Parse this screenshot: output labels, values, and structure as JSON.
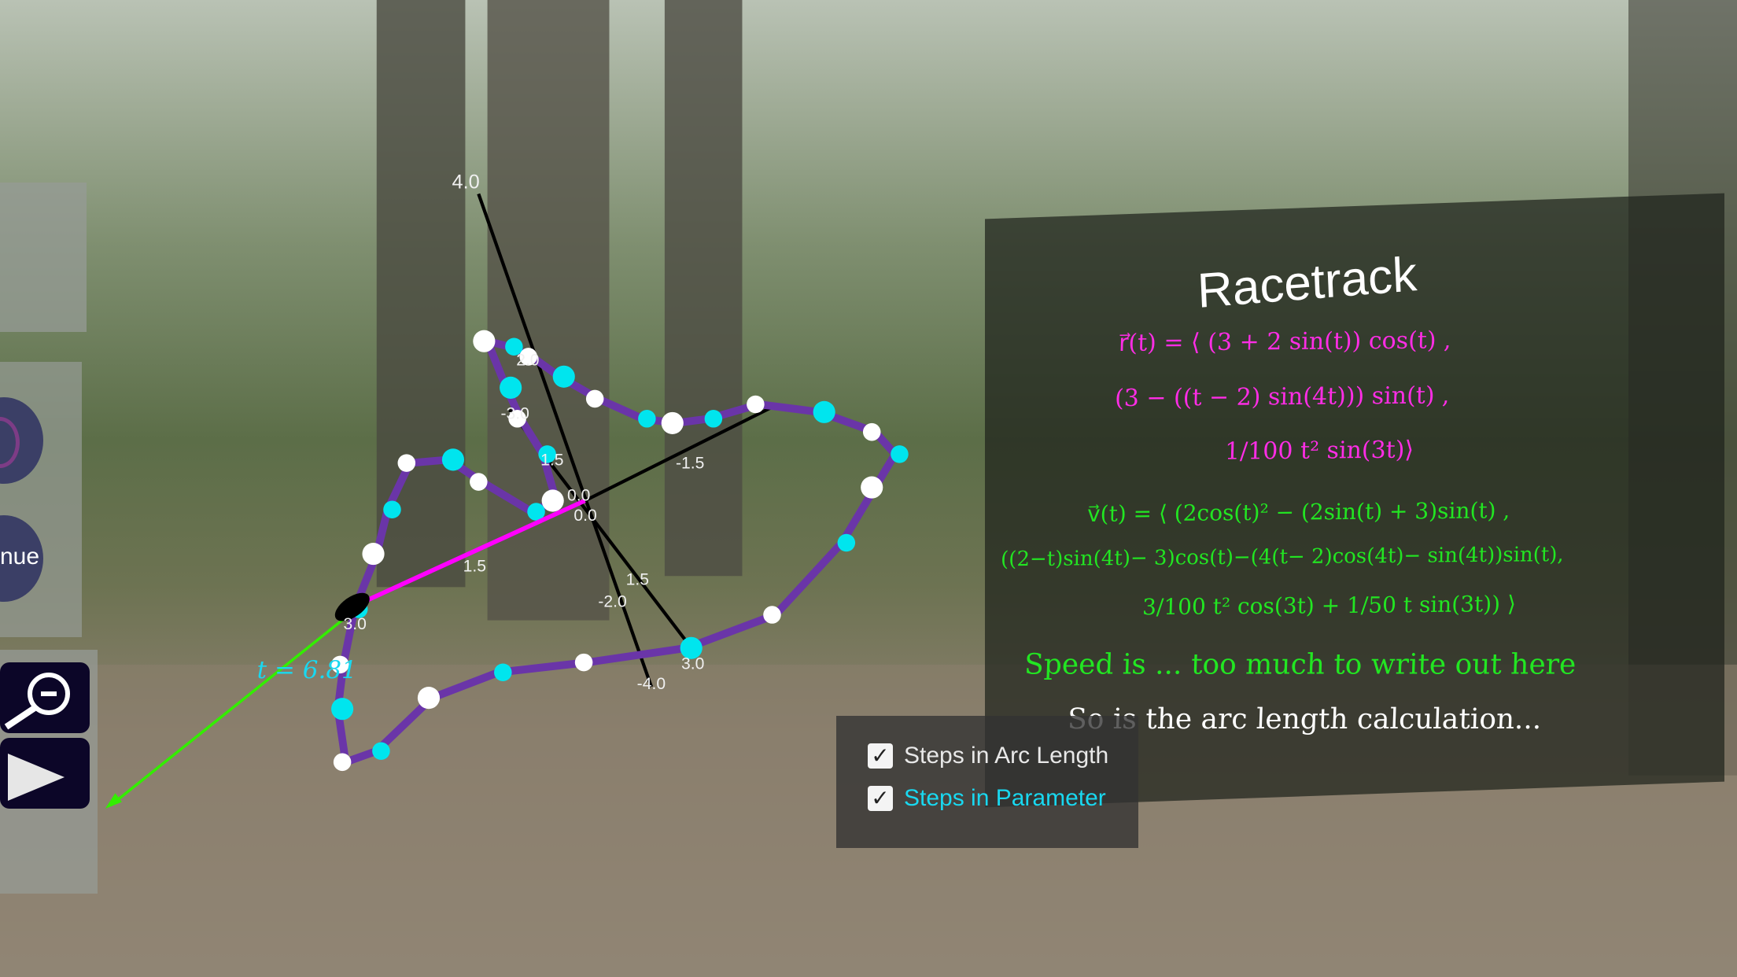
{
  "left_panel": {
    "continue_fragment": "nue",
    "zoom_icon": "zoom-out-icon",
    "play_icon": "play-icon"
  },
  "scene": {
    "parameter_label": "t = 6.81",
    "axis_labels": [
      "4.0",
      "2.0",
      "-3.0",
      "1.5",
      "0.0",
      "0.0",
      "-1.5",
      "1.5",
      "1.5",
      "-2.0",
      "3.0",
      "3.0",
      "-4.0"
    ],
    "colors": {
      "track": "#6a35a8",
      "arc_dot": "#ffffff",
      "param_dot": "#00e5ee",
      "position_vector": "#ff00ff",
      "velocity_vector": "#33ee00",
      "axes": "#000000"
    }
  },
  "info_panel": {
    "title": "Racetrack",
    "r_lines": [
      "r⃗(t) = ⟨ (3 + 2 sin(t)) cos(t) ,",
      "(3 − ((t − 2) sin(4t))) sin(t) ,",
      "1/100 t² sin(3t)⟩"
    ],
    "v_lines": [
      "v⃗(t) = ⟨ (2cos(t)² − (2sin(t) + 3)sin(t) ,",
      "((2−t)sin(4t)− 3)cos(t)−(4(t− 2)cos(4t)− sin(4t))sin(t),",
      "3/100 t² cos(3t) + 1/50 t sin(3t)) ⟩"
    ],
    "speed_text": "Speed is ...  too much to write out here",
    "arc_text": "So is the arc length calculation..."
  },
  "checkboxes": [
    {
      "label": "Steps in Arc Length",
      "checked": true,
      "color": "#e8e8e8"
    },
    {
      "label": "Steps in Parameter",
      "checked": true,
      "color": "#19d8f0"
    }
  ]
}
